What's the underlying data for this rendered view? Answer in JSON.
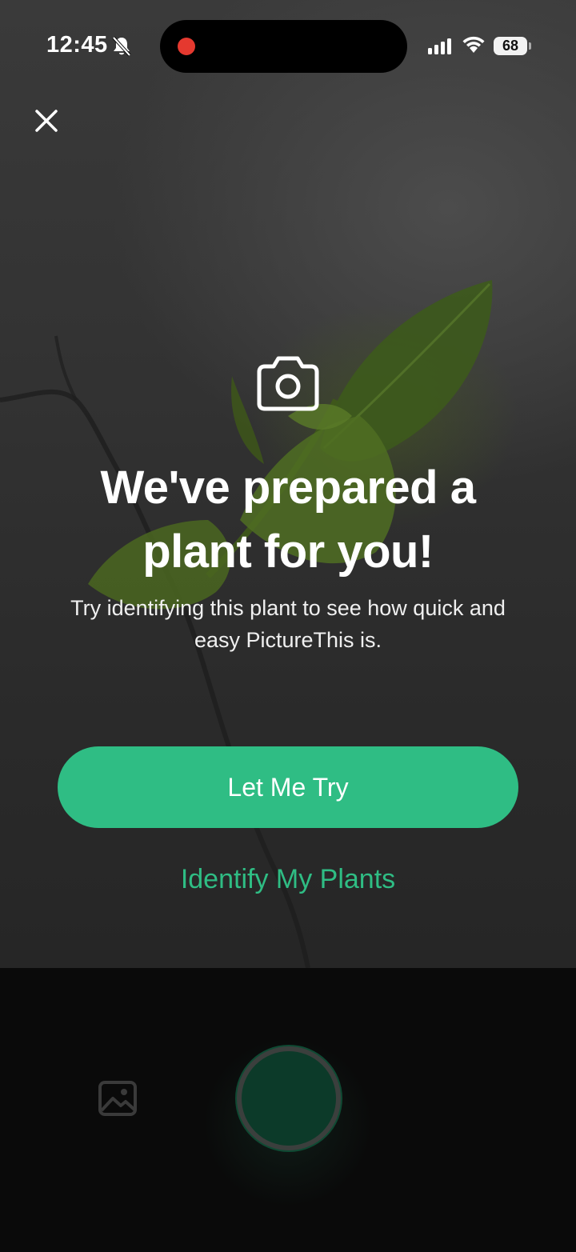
{
  "status_bar": {
    "time": "12:45",
    "battery": "68",
    "icons": [
      "bell-slash-icon",
      "cellular-signal-icon",
      "wifi-icon",
      "battery-icon"
    ],
    "recording_color": "#e5392f"
  },
  "dialog": {
    "close_icon": "close-icon",
    "camera_icon": "camera-icon",
    "title": "We've prepared a plant for you!",
    "subtitle": "Try identifying this plant to see how quick and easy PictureThis is.",
    "primary_button": "Let Me Try",
    "secondary_link": "Identify My Plants"
  },
  "camera_controls": {
    "gallery_icon": "gallery-image-icon",
    "shutter": "shutter-button"
  },
  "colors": {
    "accent": "#2fbd84",
    "background": "#0a0a0a",
    "text": "#ffffff"
  }
}
